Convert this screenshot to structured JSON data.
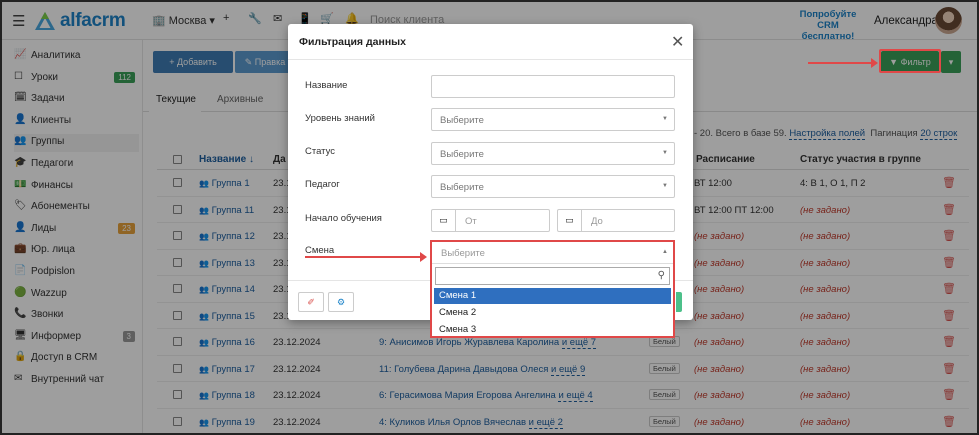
{
  "header": {
    "logo_text": "alfacrm",
    "city": "Москва",
    "search_placeholder": "Поиск клиента",
    "try_line1": "Попробуйте",
    "try_line2": "CRM бесплатно!",
    "user_name": "Александра"
  },
  "sidebar": {
    "items": [
      {
        "icon": "📈",
        "label": "Аналитика",
        "badge": ""
      },
      {
        "icon": "☐",
        "label": "Уроки",
        "badge": "112",
        "badge_color": "#3aa05a"
      },
      {
        "icon": "🗓",
        "label": "Задачи",
        "badge": ""
      },
      {
        "icon": "👤",
        "label": "Клиенты",
        "badge": ""
      },
      {
        "icon": "👥",
        "label": "Группы",
        "badge": ""
      },
      {
        "icon": "🎓",
        "label": "Педагоги",
        "badge": ""
      },
      {
        "icon": "💵",
        "label": "Финансы",
        "badge": ""
      },
      {
        "icon": "🏷",
        "label": "Абонементы",
        "badge": ""
      },
      {
        "icon": "👤",
        "label": "Лиды",
        "badge": "23",
        "badge_color": "#e8a33d"
      },
      {
        "icon": "💼",
        "label": "Юр. лица",
        "badge": ""
      },
      {
        "icon": "📄",
        "label": "Podpislon",
        "badge": ""
      },
      {
        "icon": "🟢",
        "label": "Wazzup",
        "badge": ""
      },
      {
        "icon": "📞",
        "label": "Звонки",
        "badge": ""
      },
      {
        "icon": "🖥",
        "label": "Информер",
        "badge": "3",
        "badge_color": "#9a9a9a"
      },
      {
        "icon": "🔒",
        "label": "Доступ в CRM",
        "badge": ""
      },
      {
        "icon": "✉",
        "label": "Внутренний чат",
        "badge": ""
      }
    ]
  },
  "toolbar": {
    "add_label": "+ Добавить",
    "edit_label": "✎ Правка",
    "filter_label": "▼ Фильтр"
  },
  "tabs": {
    "current": "Текущие",
    "archive": "Архивные"
  },
  "info": {
    "range_text": "- 20. Всего в базе 59.",
    "columns_link": "Настройка полей",
    "pagination_label": "Пагинация",
    "pagination_link": "20 строк"
  },
  "table": {
    "headers": {
      "name": "Название ↓",
      "date": "Да",
      "schedule": "Расписание",
      "status": "Статус участия в группе"
    },
    "rows": [
      {
        "name": "Группа 1",
        "date": "23.1",
        "members": "",
        "more": "",
        "level": "",
        "schedule": "ВТ 12:00",
        "status": "4: В 1, О 1, П 2",
        "status_notset": false
      },
      {
        "name": "Группа 11",
        "date": "23.1",
        "members": "",
        "more": "",
        "level": "",
        "schedule": "ВТ 12:00  ПТ 12:00",
        "status": "(не задано)",
        "status_notset": true
      },
      {
        "name": "Группа 12",
        "date": "23.1",
        "members": "",
        "more": "",
        "level": "",
        "schedule": "(не задано)",
        "status": "(не задано)",
        "status_notset": true
      },
      {
        "name": "Группа 13",
        "date": "23.1",
        "members": "",
        "more": "",
        "level": "",
        "schedule": "(не задано)",
        "status": "(не задано)",
        "status_notset": true
      },
      {
        "name": "Группа 14",
        "date": "23.1",
        "members": "",
        "more": "",
        "level": "",
        "schedule": "(не задано)",
        "status": "(не задано)",
        "status_notset": true
      },
      {
        "name": "Группа 15",
        "date": "23.1",
        "members": "",
        "more": "",
        "level": "",
        "schedule": "(не задано)",
        "status": "(не задано)",
        "status_notset": true
      },
      {
        "name": "Группа 16",
        "date": "23.12.2024",
        "members": "9:  Анисимов Игорь  Журавлева Каролина",
        "more": "и ещё 7",
        "level": "Белый",
        "schedule": "(не задано)",
        "status": "(не задано)",
        "status_notset": true
      },
      {
        "name": "Группа 17",
        "date": "23.12.2024",
        "members": "11:  Голубева Дарина  Давыдова Олеся",
        "more": "и ещё 9",
        "level": "Белый",
        "schedule": "(не задано)",
        "status": "(не задано)",
        "status_notset": true
      },
      {
        "name": "Группа 18",
        "date": "23.12.2024",
        "members": "6:  Герасимова Мария  Егорова Ангелина",
        "more": "и ещё 4",
        "level": "Белый",
        "schedule": "(не задано)",
        "status": "(не задано)",
        "status_notset": true
      },
      {
        "name": "Группа 19",
        "date": "23.12.2024",
        "members": "4:  Куликов Илья  Орлов Вячеслав",
        "more": "и ещё 2",
        "level": "Белый",
        "schedule": "(не задано)",
        "status": "(не задано)",
        "status_notset": true
      }
    ]
  },
  "modal": {
    "title": "Фильтрация данных",
    "fields": {
      "name_label": "Название",
      "level_label": "Уровень знаний",
      "level_placeholder": "Выберите",
      "status_label": "Статус",
      "status_placeholder": "Выберите",
      "teacher_label": "Педагог",
      "teacher_placeholder": "Выберите",
      "start_label": "Начало обучения",
      "from_placeholder": "От",
      "to_placeholder": "До",
      "shift_label": "Смена",
      "shift_placeholder": "Выберите"
    }
  },
  "dropdown": {
    "options": [
      "Смена 1",
      "Смена 2",
      "Смена 3"
    ],
    "selected": "Смена 1"
  },
  "colors": {
    "accent": "#1d84c9",
    "highlight": "#e04848",
    "selected_option": "#2f6fbf",
    "filter_button": "#3aa05a"
  }
}
